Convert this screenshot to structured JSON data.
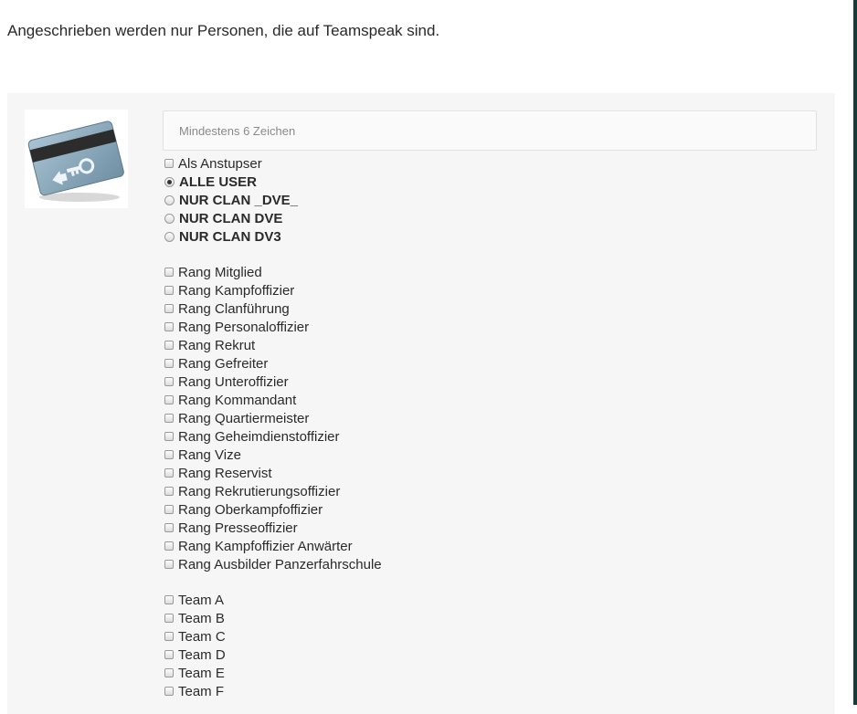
{
  "notice": "Angeschrieben werden nur Personen, die auf Teamspeak sind.",
  "icon": "keycard-icon",
  "password_placeholder": "Mindestens 6 Zeichen",
  "poke_option": "Als Anstupser",
  "target_group": {
    "selected": "ALLE USER",
    "options": [
      "ALLE USER",
      "NUR CLAN _DVE_",
      "NUR CLAN DVE",
      "NUR CLAN DV3"
    ]
  },
  "ranks": [
    "Rang Mitglied",
    "Rang Kampfoffizier",
    "Rang Clanführung",
    "Rang Personaloffizier",
    "Rang Rekrut",
    "Rang Gefreiter",
    "Rang Unteroffizier",
    "Rang Kommandant",
    "Rang Quartiermeister",
    "Rang Geheimdienstoffizier",
    "Rang Vize",
    "Rang Reservist",
    "Rang Rekrutierungsoffizier",
    "Rang Oberkampfoffizier",
    "Rang Presseoffizier",
    "Rang Kampfoffizier Anwärter",
    "Rang Ausbilder Panzerfahrschule"
  ],
  "teams": [
    "Team A",
    "Team B",
    "Team C",
    "Team D",
    "Team E",
    "Team F"
  ],
  "colors": {
    "panel_bg": "#f6f6f6",
    "right_border": "#173a3a"
  }
}
